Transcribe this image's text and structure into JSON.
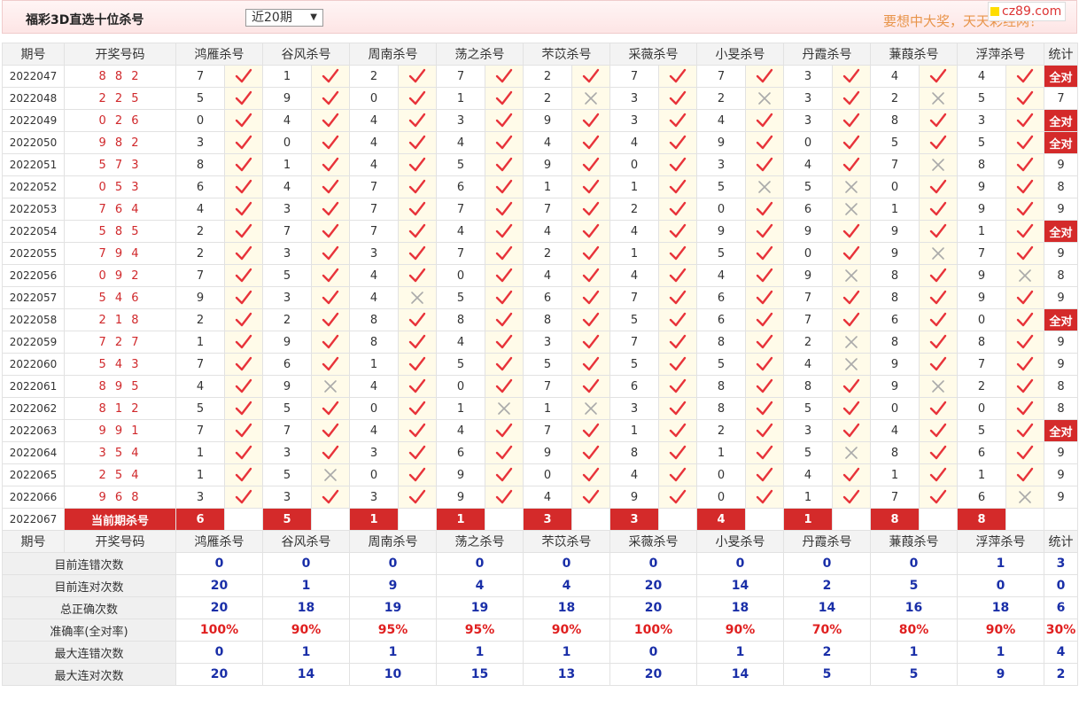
{
  "header": {
    "title": "福彩3D直选十位杀号",
    "period_select": "近20期",
    "slogan": "要想中大奖，天天彩经网！",
    "brand": "cz89.com"
  },
  "columns": {
    "period": "期号",
    "draw": "开奖号码",
    "experts": [
      "鸿雁杀号",
      "谷风杀号",
      "周南杀号",
      "荡之杀号",
      "芣苡杀号",
      "采薇杀号",
      "小旻杀号",
      "丹霞杀号",
      "蒹葭杀号",
      "浮萍杀号"
    ],
    "stat": "统计"
  },
  "rows": [
    {
      "period": "2022047",
      "draw": "8 8 2",
      "vals": [
        "7",
        "1",
        "2",
        "7",
        "2",
        "7",
        "7",
        "3",
        "4",
        "4"
      ],
      "marks": [
        "y",
        "y",
        "y",
        "y",
        "y",
        "y",
        "y",
        "y",
        "y",
        "y"
      ],
      "stat": "全对"
    },
    {
      "period": "2022048",
      "draw": "2 2 5",
      "vals": [
        "5",
        "9",
        "0",
        "1",
        "2",
        "3",
        "2",
        "3",
        "2",
        "5"
      ],
      "marks": [
        "y",
        "y",
        "y",
        "y",
        "n",
        "y",
        "n",
        "y",
        "n",
        "y"
      ],
      "stat": "7"
    },
    {
      "period": "2022049",
      "draw": "0 2 6",
      "vals": [
        "0",
        "4",
        "4",
        "3",
        "9",
        "3",
        "4",
        "3",
        "8",
        "3"
      ],
      "marks": [
        "y",
        "y",
        "y",
        "y",
        "y",
        "y",
        "y",
        "y",
        "y",
        "y"
      ],
      "stat": "全对"
    },
    {
      "period": "2022050",
      "draw": "9 8 2",
      "vals": [
        "3",
        "0",
        "4",
        "4",
        "4",
        "4",
        "9",
        "0",
        "5",
        "5"
      ],
      "marks": [
        "y",
        "y",
        "y",
        "y",
        "y",
        "y",
        "y",
        "y",
        "y",
        "y"
      ],
      "stat": "全对"
    },
    {
      "period": "2022051",
      "draw": "5 7 3",
      "vals": [
        "8",
        "1",
        "4",
        "5",
        "9",
        "0",
        "3",
        "4",
        "7",
        "8"
      ],
      "marks": [
        "y",
        "y",
        "y",
        "y",
        "y",
        "y",
        "y",
        "y",
        "n",
        "y"
      ],
      "stat": "9"
    },
    {
      "period": "2022052",
      "draw": "0 5 3",
      "vals": [
        "6",
        "4",
        "7",
        "6",
        "1",
        "1",
        "5",
        "5",
        "0",
        "9"
      ],
      "marks": [
        "y",
        "y",
        "y",
        "y",
        "y",
        "y",
        "n",
        "n",
        "y",
        "y"
      ],
      "stat": "8"
    },
    {
      "period": "2022053",
      "draw": "7 6 4",
      "vals": [
        "4",
        "3",
        "7",
        "7",
        "7",
        "2",
        "0",
        "6",
        "1",
        "9"
      ],
      "marks": [
        "y",
        "y",
        "y",
        "y",
        "y",
        "y",
        "y",
        "n",
        "y",
        "y"
      ],
      "stat": "9"
    },
    {
      "period": "2022054",
      "draw": "5 8 5",
      "vals": [
        "2",
        "7",
        "7",
        "4",
        "4",
        "4",
        "9",
        "9",
        "9",
        "1"
      ],
      "marks": [
        "y",
        "y",
        "y",
        "y",
        "y",
        "y",
        "y",
        "y",
        "y",
        "y"
      ],
      "stat": "全对"
    },
    {
      "period": "2022055",
      "draw": "7 9 4",
      "vals": [
        "2",
        "3",
        "3",
        "7",
        "2",
        "1",
        "5",
        "0",
        "9",
        "7"
      ],
      "marks": [
        "y",
        "y",
        "y",
        "y",
        "y",
        "y",
        "y",
        "y",
        "n",
        "y"
      ],
      "stat": "9"
    },
    {
      "period": "2022056",
      "draw": "0 9 2",
      "vals": [
        "7",
        "5",
        "4",
        "0",
        "4",
        "4",
        "4",
        "9",
        "8",
        "9"
      ],
      "marks": [
        "y",
        "y",
        "y",
        "y",
        "y",
        "y",
        "y",
        "n",
        "y",
        "n"
      ],
      "stat": "8"
    },
    {
      "period": "2022057",
      "draw": "5 4 6",
      "vals": [
        "9",
        "3",
        "4",
        "5",
        "6",
        "7",
        "6",
        "7",
        "8",
        "9"
      ],
      "marks": [
        "y",
        "y",
        "n",
        "y",
        "y",
        "y",
        "y",
        "y",
        "y",
        "y"
      ],
      "stat": "9"
    },
    {
      "period": "2022058",
      "draw": "2 1 8",
      "vals": [
        "2",
        "2",
        "8",
        "8",
        "8",
        "5",
        "6",
        "7",
        "6",
        "0"
      ],
      "marks": [
        "y",
        "y",
        "y",
        "y",
        "y",
        "y",
        "y",
        "y",
        "y",
        "y"
      ],
      "stat": "全对"
    },
    {
      "period": "2022059",
      "draw": "7 2 7",
      "vals": [
        "1",
        "9",
        "8",
        "4",
        "3",
        "7",
        "8",
        "2",
        "8",
        "8"
      ],
      "marks": [
        "y",
        "y",
        "y",
        "y",
        "y",
        "y",
        "y",
        "n",
        "y",
        "y"
      ],
      "stat": "9"
    },
    {
      "period": "2022060",
      "draw": "5 4 3",
      "vals": [
        "7",
        "6",
        "1",
        "5",
        "5",
        "5",
        "5",
        "4",
        "9",
        "7"
      ],
      "marks": [
        "y",
        "y",
        "y",
        "y",
        "y",
        "y",
        "y",
        "n",
        "y",
        "y"
      ],
      "stat": "9"
    },
    {
      "period": "2022061",
      "draw": "8 9 5",
      "vals": [
        "4",
        "9",
        "4",
        "0",
        "7",
        "6",
        "8",
        "8",
        "9",
        "2"
      ],
      "marks": [
        "y",
        "n",
        "y",
        "y",
        "y",
        "y",
        "y",
        "y",
        "n",
        "y"
      ],
      "stat": "8"
    },
    {
      "period": "2022062",
      "draw": "8 1 2",
      "vals": [
        "5",
        "5",
        "0",
        "1",
        "1",
        "3",
        "8",
        "5",
        "0",
        "0"
      ],
      "marks": [
        "y",
        "y",
        "y",
        "n",
        "n",
        "y",
        "y",
        "y",
        "y",
        "y"
      ],
      "stat": "8"
    },
    {
      "period": "2022063",
      "draw": "9 9 1",
      "vals": [
        "7",
        "7",
        "4",
        "4",
        "7",
        "1",
        "2",
        "3",
        "4",
        "5"
      ],
      "marks": [
        "y",
        "y",
        "y",
        "y",
        "y",
        "y",
        "y",
        "y",
        "y",
        "y"
      ],
      "stat": "全对"
    },
    {
      "period": "2022064",
      "draw": "3 5 4",
      "vals": [
        "1",
        "3",
        "3",
        "6",
        "9",
        "8",
        "1",
        "5",
        "8",
        "6"
      ],
      "marks": [
        "y",
        "y",
        "y",
        "y",
        "y",
        "y",
        "y",
        "n",
        "y",
        "y"
      ],
      "stat": "9"
    },
    {
      "period": "2022065",
      "draw": "2 5 4",
      "vals": [
        "1",
        "5",
        "0",
        "9",
        "0",
        "4",
        "0",
        "4",
        "1",
        "1"
      ],
      "marks": [
        "y",
        "n",
        "y",
        "y",
        "y",
        "y",
        "y",
        "y",
        "y",
        "y"
      ],
      "stat": "9"
    },
    {
      "period": "2022066",
      "draw": "9 6 8",
      "vals": [
        "3",
        "3",
        "3",
        "9",
        "4",
        "9",
        "0",
        "1",
        "7",
        "6"
      ],
      "marks": [
        "y",
        "y",
        "y",
        "y",
        "y",
        "y",
        "y",
        "y",
        "y",
        "n"
      ],
      "stat": "9"
    }
  ],
  "current": {
    "period": "2022067",
    "label": "当前期杀号",
    "vals": [
      "6",
      "5",
      "1",
      "1",
      "3",
      "3",
      "4",
      "1",
      "8",
      "8"
    ]
  },
  "summary": [
    {
      "label": "目前连错次数",
      "vals": [
        "0",
        "0",
        "0",
        "0",
        "0",
        "0",
        "0",
        "0",
        "0",
        "1"
      ],
      "stat": "3",
      "style": "blue"
    },
    {
      "label": "目前连对次数",
      "vals": [
        "20",
        "1",
        "9",
        "4",
        "4",
        "20",
        "14",
        "2",
        "5",
        "0"
      ],
      "stat": "0",
      "style": "blue"
    },
    {
      "label": "总正确次数",
      "vals": [
        "20",
        "18",
        "19",
        "19",
        "18",
        "20",
        "18",
        "14",
        "16",
        "18"
      ],
      "stat": "6",
      "style": "blue"
    },
    {
      "label": "准确率(全对率)",
      "vals": [
        "100%",
        "90%",
        "95%",
        "95%",
        "90%",
        "100%",
        "90%",
        "70%",
        "80%",
        "90%"
      ],
      "stat": "30%",
      "style": "pct"
    },
    {
      "label": "最大连错次数",
      "vals": [
        "0",
        "1",
        "1",
        "1",
        "1",
        "0",
        "1",
        "2",
        "1",
        "1"
      ],
      "stat": "4",
      "style": "blue"
    },
    {
      "label": "最大连对次数",
      "vals": [
        "20",
        "14",
        "10",
        "15",
        "13",
        "20",
        "14",
        "5",
        "5",
        "9"
      ],
      "stat": "2",
      "style": "blue"
    }
  ],
  "icons": {
    "correct": "check-icon",
    "wrong": "cross-icon"
  },
  "colors": {
    "check": "#e8333a",
    "cross": "#aaaaaa",
    "highlight": "#d42a2a",
    "blue": "#1a2fa8"
  }
}
